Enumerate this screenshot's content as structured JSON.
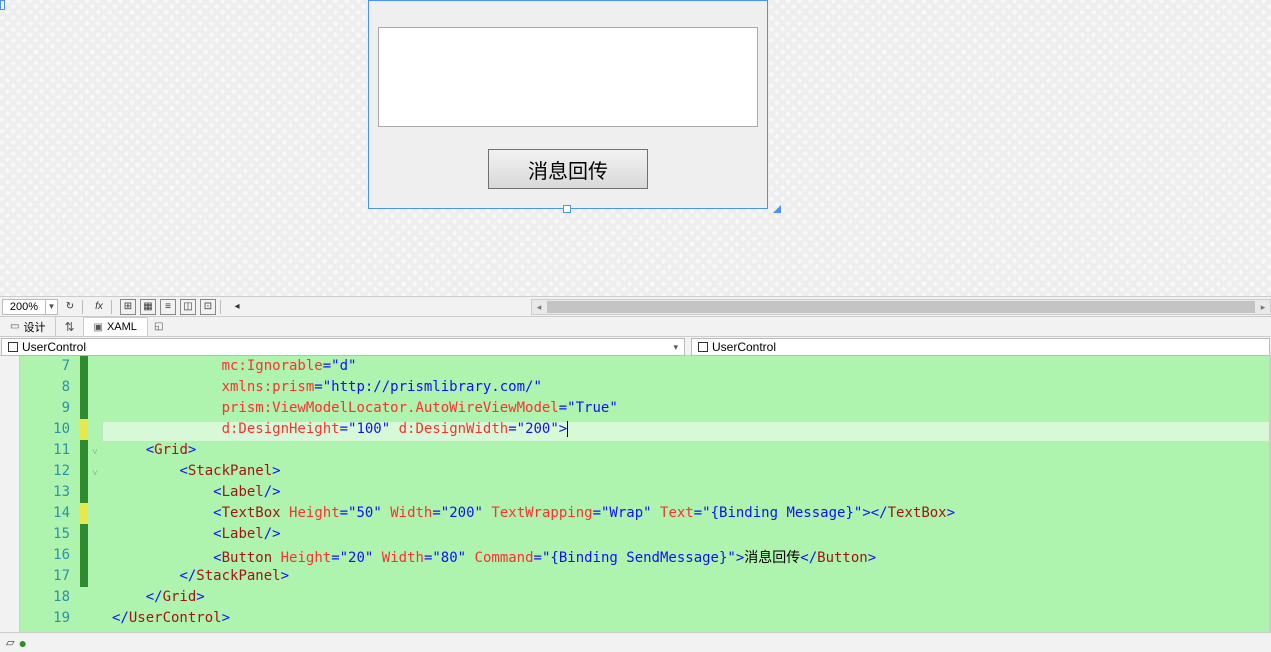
{
  "designer": {
    "button_label": "消息回传"
  },
  "toolbar": {
    "zoom": "200%"
  },
  "tabs": {
    "design": "设计",
    "xaml": "XAML"
  },
  "breadcrumb": {
    "left": "UserControl",
    "right": "UserControl"
  },
  "gutter": [
    "7",
    "8",
    "9",
    "10",
    "11",
    "12",
    "13",
    "14",
    "15",
    "16",
    "17",
    "18",
    "19"
  ],
  "code": {
    "l7": {
      "attr": "mc:Ignorable",
      "val": "d"
    },
    "l8": {
      "attr": "xmlns:prism",
      "val": "http://prismlibrary.com/"
    },
    "l9": {
      "attr": "prism:ViewModelLocator.AutoWireViewModel",
      "val": "True"
    },
    "l10": {
      "a1": "d:DesignHeight",
      "v1": "100",
      "a2": "d:DesignWidth",
      "v2": "200"
    },
    "l11": {
      "elem": "Grid"
    },
    "l12": {
      "elem": "StackPanel"
    },
    "l13": {
      "elem": "Label"
    },
    "l14": {
      "elem": "TextBox",
      "a1": "Height",
      "v1": "50",
      "a2": "Width",
      "v2": "200",
      "a3": "TextWrapping",
      "v3": "Wrap",
      "a4": "Text",
      "v4": "{Binding Message}",
      "close": "TextBox"
    },
    "l15": {
      "elem": "Label"
    },
    "l16": {
      "elem": "Button",
      "a1": "Height",
      "v1": "20",
      "a2": "Width",
      "v2": "80",
      "a3": "Command",
      "v3": "{Binding SendMessage}",
      "text": "消息回传",
      "close": "Button"
    },
    "l17": {
      "elem": "StackPanel"
    },
    "l18": {
      "elem": "Grid"
    },
    "l19": {
      "elem": "UserControl"
    }
  }
}
